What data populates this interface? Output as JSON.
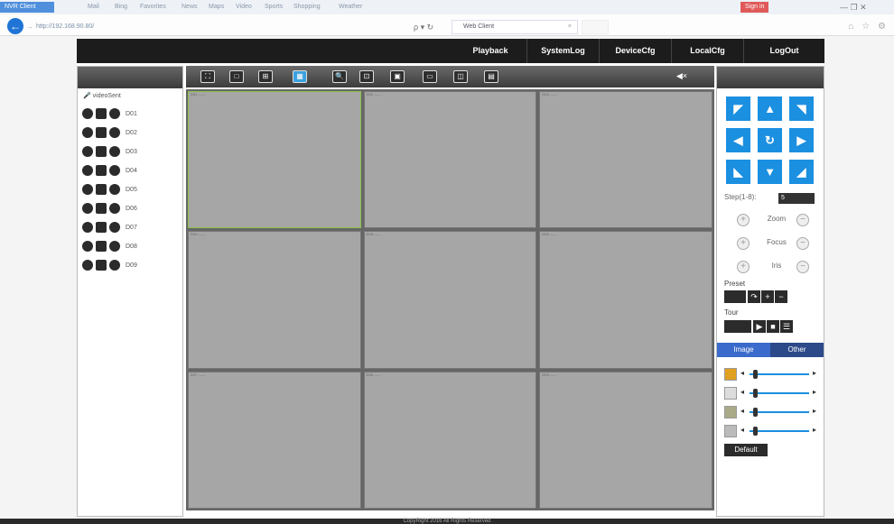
{
  "browser": {
    "active_tab": "NVR Client",
    "tabs": [
      "Mail",
      "Bing",
      "Favorites",
      "News",
      "Maps",
      "Video",
      "Sports",
      "Shopping",
      "Weather"
    ],
    "address": "http://192.168.90.80/",
    "addr_tools": "ρ ▾ ↻",
    "tab2_title": "Web Client",
    "tab2_close": "×",
    "login_label": "Sign in",
    "window_controls": "—  ❐  ✕",
    "back_glyph": "←",
    "fwd_glyph": "→",
    "right_icons": "⌂ ☆ ⚙"
  },
  "nav": {
    "items": [
      "Playback",
      "SystemLog",
      "DeviceCfg",
      "LocalCfg",
      "LogOut"
    ]
  },
  "left": {
    "device_label": "videoSent",
    "channels": [
      "D01",
      "D02",
      "D03",
      "D04",
      "D05",
      "D06",
      "D07",
      "D08",
      "D09"
    ]
  },
  "toolbar": {
    "icons": [
      "fullscreen-icon",
      "layout-1-icon",
      "layout-4-icon",
      "layout-9-icon",
      "zoom-icon",
      "record-icon",
      "snapshot-icon",
      "image-icon",
      "playback-icon",
      "stop-all-icon"
    ],
    "glyphs": [
      "⛶",
      "□",
      "⊞",
      "▦",
      "🔍",
      "⊡",
      "▣",
      "▭",
      "◫",
      "▤"
    ],
    "speaker": "◀×"
  },
  "grid": {
    "cells": [
      "D01 ------",
      "D02 ------",
      "D03 ------",
      "D04 ------",
      "D05 ------",
      "D06 ------",
      "D07 ------",
      "D08 ------",
      "D09 ------"
    ]
  },
  "ptz": {
    "glyphs": [
      "◤",
      "▲",
      "◥",
      "◀",
      "↻",
      "▶",
      "◣",
      "▼",
      "◢"
    ],
    "step_label": "Step(1-8):",
    "step_value": "5",
    "zoom": "Zoom",
    "focus": "Focus",
    "iris": "Iris",
    "plus": "+",
    "minus": "−",
    "preset_label": "Preset",
    "tour_label": "Tour",
    "tabs": [
      "Image",
      "Other"
    ],
    "default_label": "Default",
    "arrow_left": "◂",
    "arrow_right": "▸"
  },
  "footer": {
    "text": "CopyRight 2016 All Rights Reserved"
  },
  "colors": {
    "accent": "#1b8fe0",
    "nav_bg": "#1c1c1c",
    "cell_bg": "#a6a6a6"
  }
}
